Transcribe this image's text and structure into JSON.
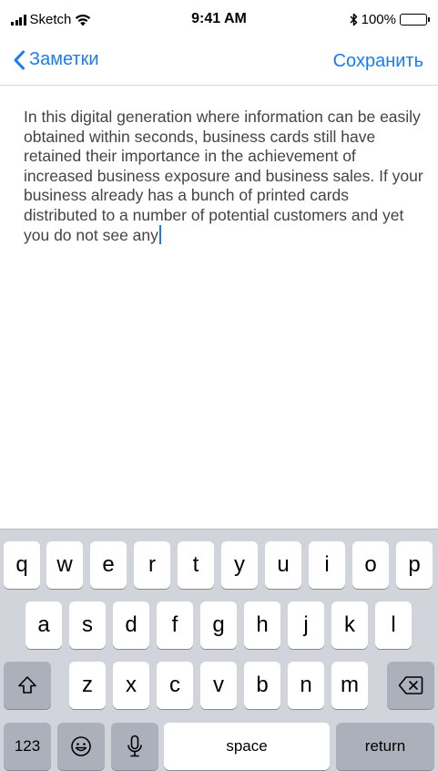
{
  "status_bar": {
    "carrier": "Sketch",
    "time": "9:41 AM",
    "battery_percent": "100%",
    "battery_level": 1.0
  },
  "nav": {
    "back_label": "Заметки",
    "save_label": "Сохранить"
  },
  "note": {
    "text": "In this digital generation where information can be easily obtained within seconds, business cards still have retained their importance in the achievement of increased business exposure and business sales. If your business already has a bunch of printed cards distributed to a number of potential customers and yet you do not see any"
  },
  "keyboard": {
    "row1": [
      "q",
      "w",
      "e",
      "r",
      "t",
      "y",
      "u",
      "i",
      "o",
      "p"
    ],
    "row2": [
      "a",
      "s",
      "d",
      "f",
      "g",
      "h",
      "j",
      "k",
      "l"
    ],
    "row3": [
      "z",
      "x",
      "c",
      "v",
      "b",
      "n",
      "m"
    ],
    "numbers_label": "123",
    "space_label": "space",
    "return_label": "return"
  },
  "colors": {
    "accent": "#1a7cf5",
    "keyboard_bg": "#d1d5db",
    "special_key": "#abb0ba"
  }
}
